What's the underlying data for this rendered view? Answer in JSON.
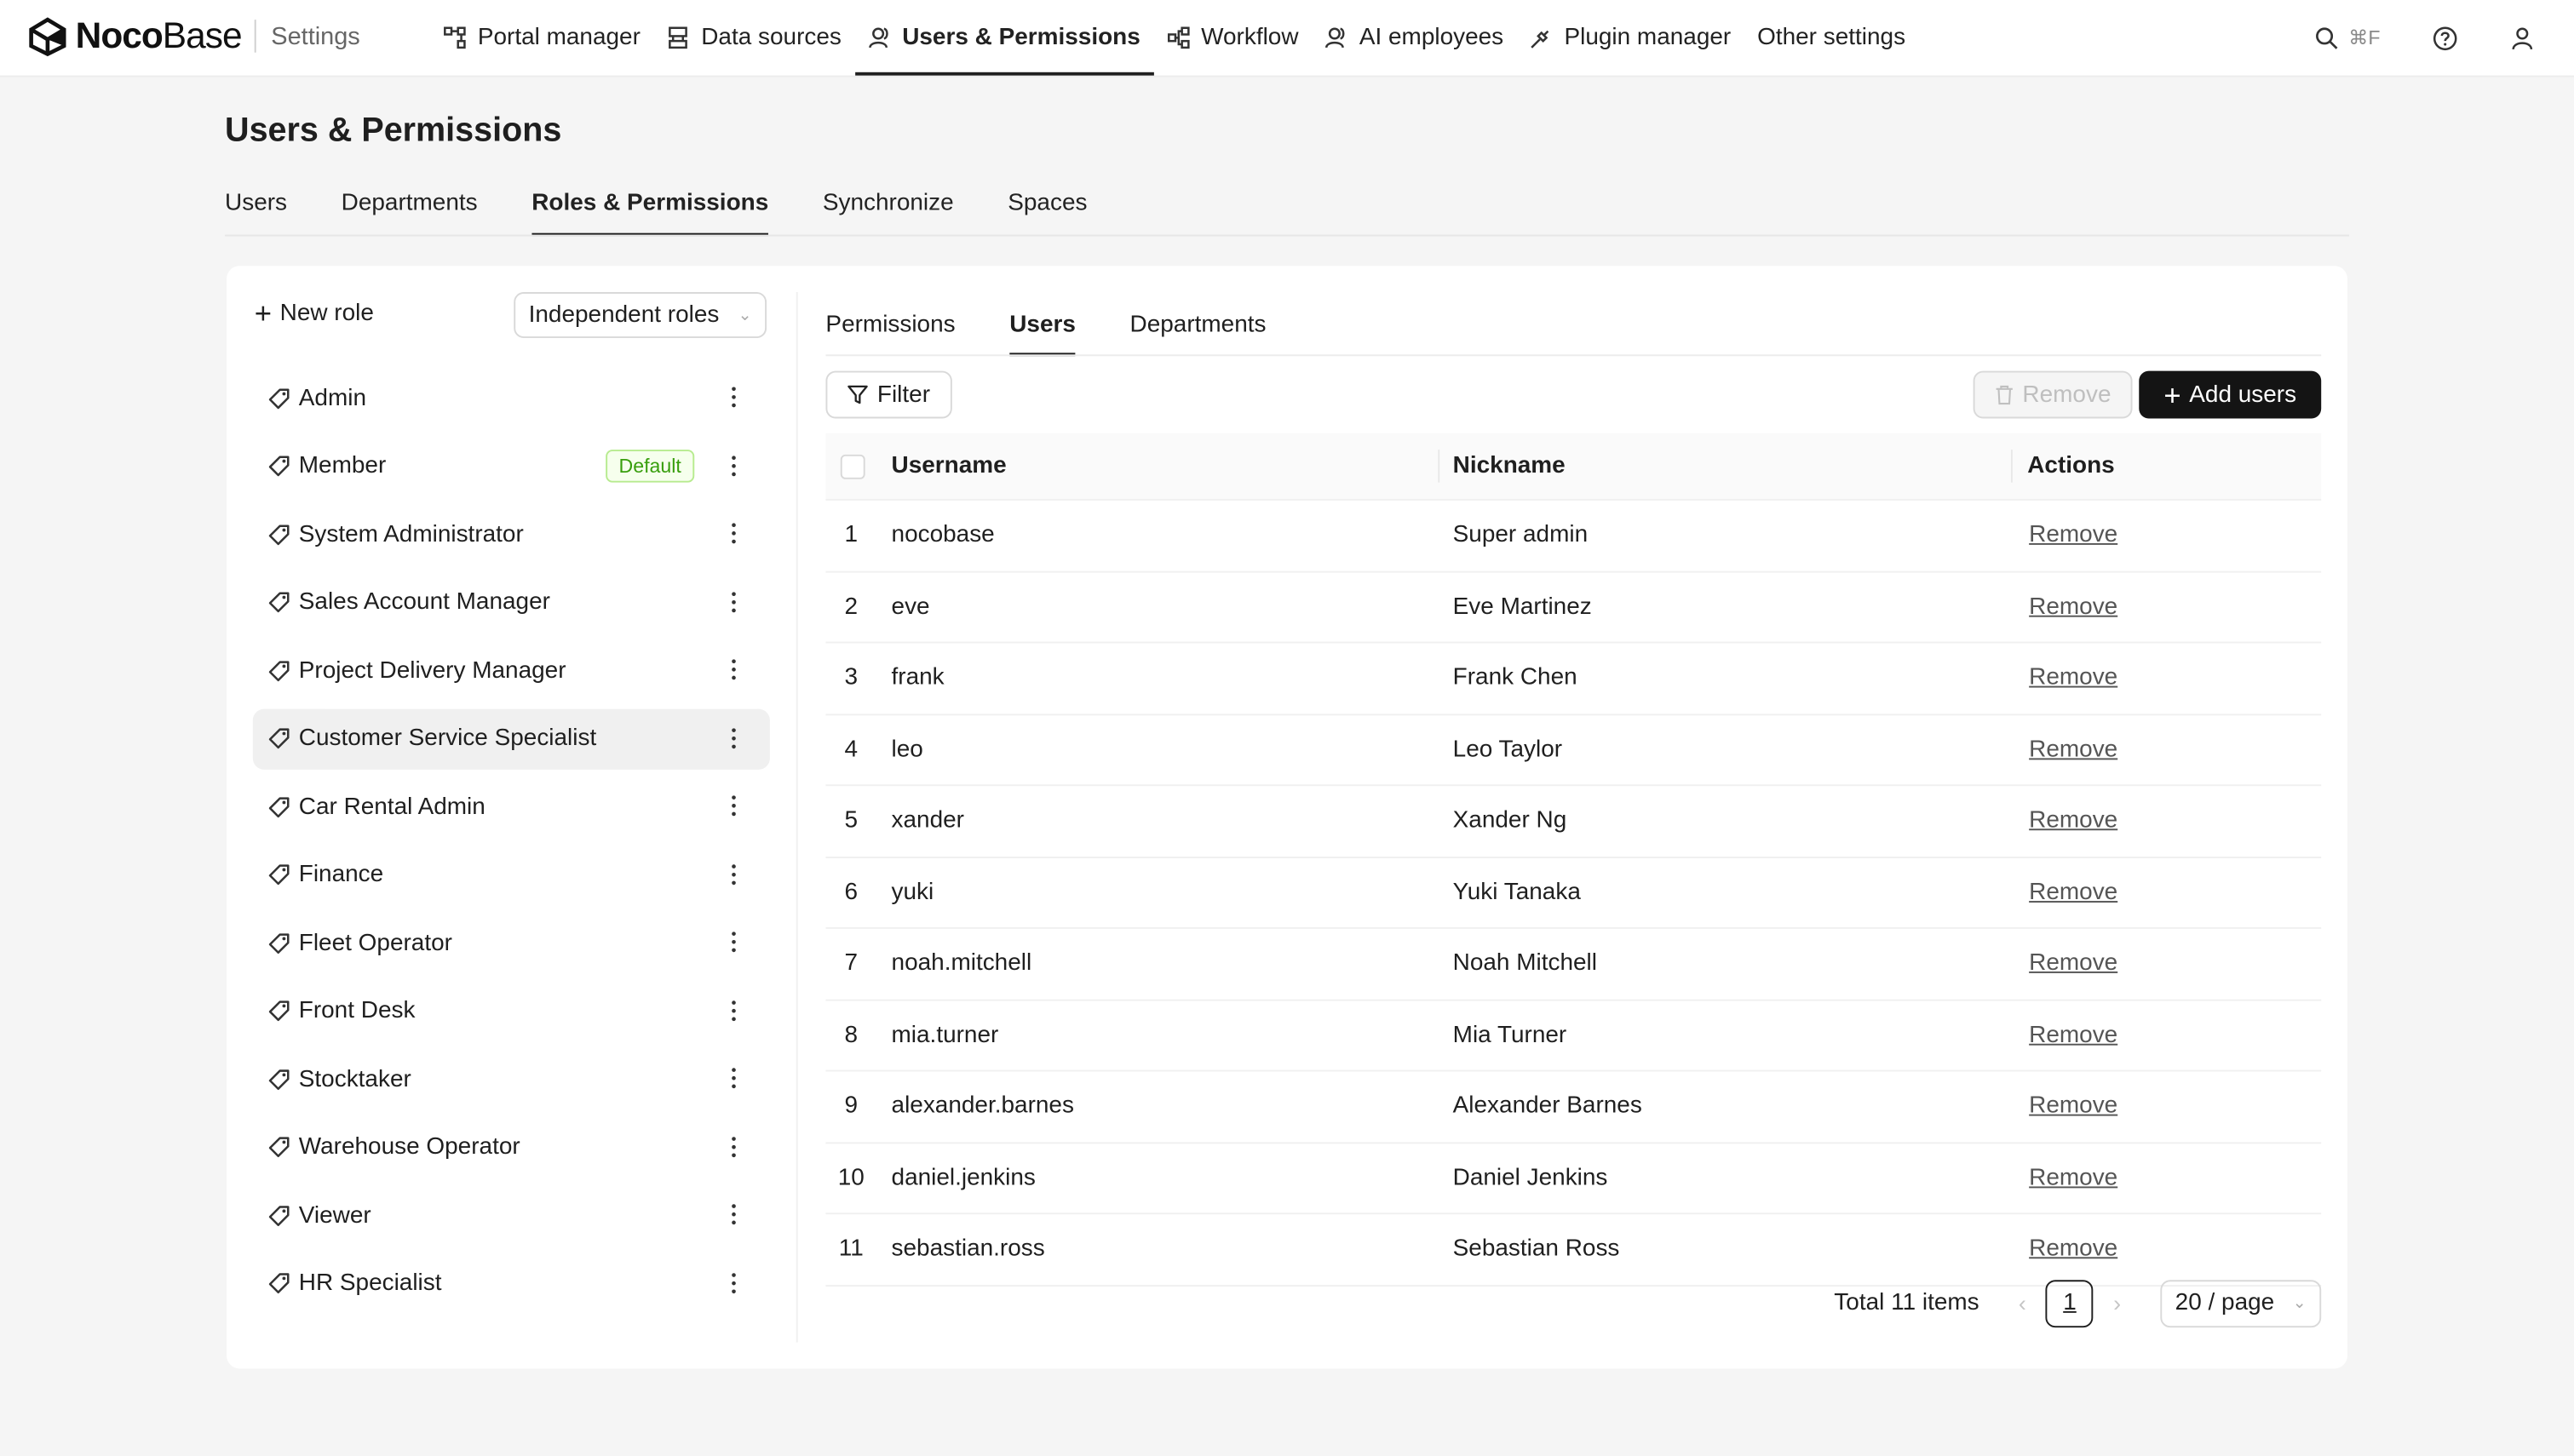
{
  "app": {
    "brand_bold": "Noco",
    "brand_light": "Base",
    "section": "Settings"
  },
  "nav": [
    {
      "label": "Portal manager",
      "icon": "portal-icon"
    },
    {
      "label": "Data sources",
      "icon": "database-icon"
    },
    {
      "label": "Users & Permissions",
      "icon": "users-icon",
      "active": true
    },
    {
      "label": "Workflow",
      "icon": "workflow-icon"
    },
    {
      "label": "AI employees",
      "icon": "ai-employee-icon"
    },
    {
      "label": "Plugin manager",
      "icon": "plugin-icon"
    },
    {
      "label": "Other settings",
      "icon": ""
    }
  ],
  "search_shortcut": "⌘F",
  "page": {
    "title": "Users & Permissions",
    "tabs": [
      "Users",
      "Departments",
      "Roles & Permissions",
      "Synchronize",
      "Spaces"
    ],
    "active_tab": "Roles & Permissions"
  },
  "roles_panel": {
    "new_role_label": "New role",
    "mode_select": "Independent roles",
    "default_badge": "Default",
    "roles": [
      {
        "name": "Admin"
      },
      {
        "name": "Member",
        "default": true
      },
      {
        "name": "System Administrator"
      },
      {
        "name": "Sales Account Manager"
      },
      {
        "name": "Project Delivery Manager"
      },
      {
        "name": "Customer Service Specialist",
        "selected": true
      },
      {
        "name": "Car Rental Admin"
      },
      {
        "name": "Finance"
      },
      {
        "name": "Fleet Operator"
      },
      {
        "name": "Front Desk"
      },
      {
        "name": "Stocktaker"
      },
      {
        "name": "Warehouse Operator"
      },
      {
        "name": "Viewer"
      },
      {
        "name": "HR Specialist"
      }
    ]
  },
  "detail": {
    "subtabs": [
      "Permissions",
      "Users",
      "Departments"
    ],
    "active_subtab": "Users",
    "filter_label": "Filter",
    "remove_label": "Remove",
    "add_users_label": "Add users",
    "columns": {
      "username": "Username",
      "nickname": "Nickname",
      "actions": "Actions"
    },
    "row_action": "Remove",
    "rows": [
      {
        "idx": "1",
        "username": "nocobase",
        "nickname": "Super admin"
      },
      {
        "idx": "2",
        "username": "eve",
        "nickname": "Eve Martinez"
      },
      {
        "idx": "3",
        "username": "frank",
        "nickname": "Frank Chen"
      },
      {
        "idx": "4",
        "username": "leo",
        "nickname": "Leo Taylor"
      },
      {
        "idx": "5",
        "username": "xander",
        "nickname": "Xander Ng"
      },
      {
        "idx": "6",
        "username": "yuki",
        "nickname": "Yuki Tanaka"
      },
      {
        "idx": "7",
        "username": "noah.mitchell",
        "nickname": "Noah Mitchell"
      },
      {
        "idx": "8",
        "username": "mia.turner",
        "nickname": "Mia Turner"
      },
      {
        "idx": "9",
        "username": "alexander.barnes",
        "nickname": "Alexander Barnes"
      },
      {
        "idx": "10",
        "username": "daniel.jenkins",
        "nickname": "Daniel Jenkins"
      },
      {
        "idx": "11",
        "username": "sebastian.ross",
        "nickname": "Sebastian Ross"
      }
    ],
    "pagination": {
      "total": "Total 11 items",
      "page": "1",
      "page_size": "20 / page"
    }
  }
}
